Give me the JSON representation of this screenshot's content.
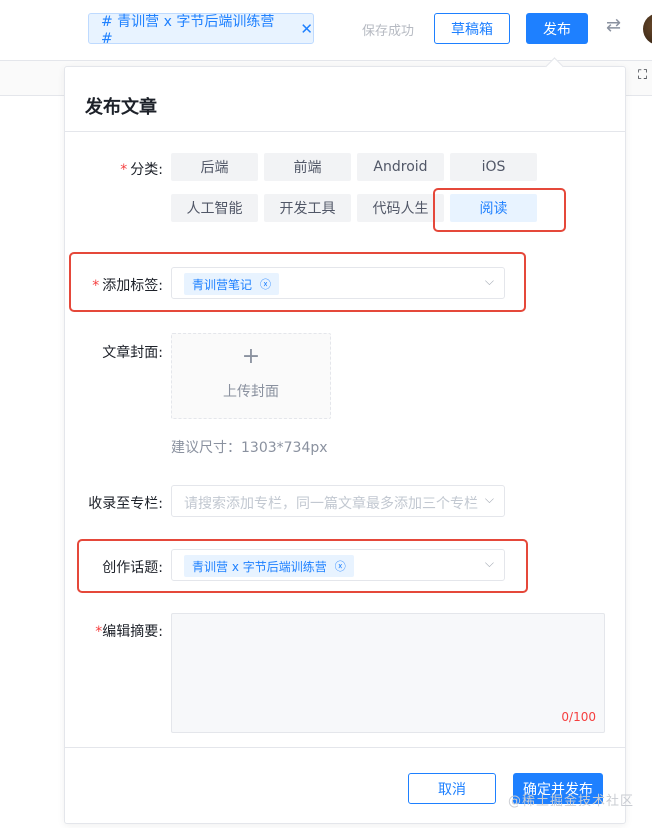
{
  "topbar": {
    "topic_chip": "# 青训营 x 字节后端训练营 #",
    "topic_chip_close": "✕",
    "save_status": "保存成功",
    "draft_button": "草稿箱",
    "publish_button": "发布"
  },
  "panel": {
    "title": "发布文章",
    "category": {
      "label": "分类:",
      "options": [
        "后端",
        "前端",
        "Android",
        "iOS",
        "人工智能",
        "开发工具",
        "代码人生",
        "阅读"
      ],
      "selected": "阅读"
    },
    "tags": {
      "label": "添加标签:",
      "chips": [
        "青训营笔记"
      ]
    },
    "cover": {
      "label": "文章封面:",
      "plus": "+",
      "upload_text": "上传封面",
      "hint": "建议尺寸：1303*734px"
    },
    "column": {
      "label": "收录至专栏:",
      "placeholder": "请搜索添加专栏，同一篇文章最多添加三个专栏"
    },
    "topic": {
      "label": "创作话题:",
      "chips": [
        "青训营 x 字节后端训练营"
      ]
    },
    "summary": {
      "label": "编辑摘要:",
      "counter": "0/100"
    },
    "cancel_button": "取消",
    "confirm_button": "确定并发布"
  },
  "watermark": "@稀土掘金技术社区",
  "colors": {
    "accent": "#1e80ff",
    "required": "#f53f3f",
    "annotation": "#e5483a"
  }
}
